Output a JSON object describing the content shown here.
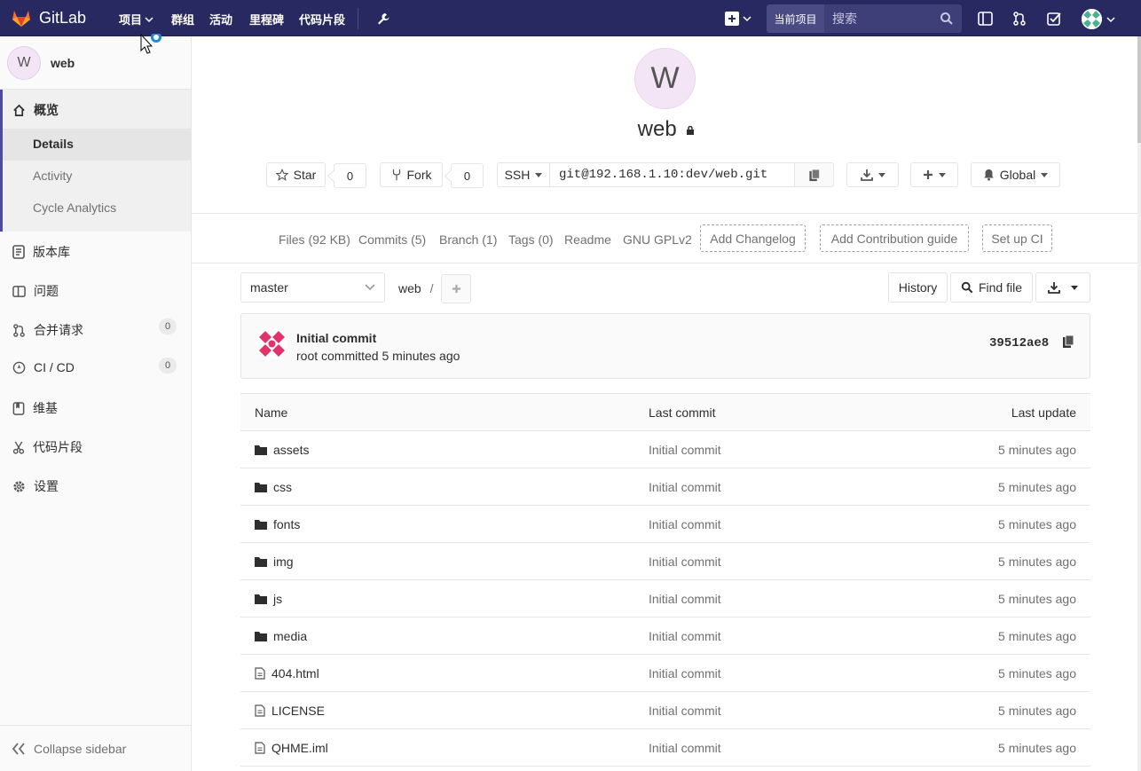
{
  "navbar": {
    "brand": "GitLab",
    "links": [
      "项目",
      "群组",
      "活动",
      "里程碑",
      "代码片段"
    ],
    "scope": "当前项目",
    "search_placeholder": "搜索"
  },
  "sidebar": {
    "project_initial": "W",
    "project_name": "web",
    "overview_label": "概览",
    "sub_items": [
      "Details",
      "Activity",
      "Cycle Analytics"
    ],
    "items": [
      {
        "label": "版本库",
        "icon": "repository-icon"
      },
      {
        "label": "问题",
        "icon": "issues-icon",
        "badge": "0"
      },
      {
        "label": "合并请求",
        "icon": "merge-request-icon",
        "badge": "0"
      },
      {
        "label": "CI / CD",
        "icon": "rocket-icon"
      },
      {
        "label": "维基",
        "icon": "book-icon"
      },
      {
        "label": "代码片段",
        "icon": "scissors-icon"
      },
      {
        "label": "设置",
        "icon": "gear-icon"
      }
    ],
    "collapse_label": "Collapse sidebar"
  },
  "project": {
    "initial": "W",
    "name": "web",
    "star_label": "Star",
    "star_count": "0",
    "fork_label": "Fork",
    "fork_count": "0",
    "clone_protocol": "SSH",
    "clone_url": "git@192.168.1.10:dev/web.git",
    "notification_label": "Global"
  },
  "stats": {
    "files": "Files (92 KB)",
    "commits": "Commits (5)",
    "branch": "Branch (1)",
    "tags": "Tags (0)",
    "readme": "Readme",
    "license": "GNU GPLv2",
    "add_changelog": "Add Changelog",
    "add_contribution": "Add Contribution guide",
    "setup_ci": "Set up CI"
  },
  "tree_nav": {
    "branch": "master",
    "crumb": "web",
    "crumb_sep": "/",
    "history_label": "History",
    "find_file_label": "Find file"
  },
  "last_commit": {
    "title": "Initial commit",
    "meta": "root committed 5 minutes ago",
    "sha": "39512ae8"
  },
  "tree": {
    "headers": {
      "name": "Name",
      "last_commit": "Last commit",
      "last_update": "Last update"
    },
    "rows": [
      {
        "name": "assets",
        "type": "folder",
        "commit": "Initial commit",
        "updated": "5 minutes ago"
      },
      {
        "name": "css",
        "type": "folder",
        "commit": "Initial commit",
        "updated": "5 minutes ago"
      },
      {
        "name": "fonts",
        "type": "folder",
        "commit": "Initial commit",
        "updated": "5 minutes ago"
      },
      {
        "name": "img",
        "type": "folder",
        "commit": "Initial commit",
        "updated": "5 minutes ago"
      },
      {
        "name": "js",
        "type": "folder",
        "commit": "Initial commit",
        "updated": "5 minutes ago"
      },
      {
        "name": "media",
        "type": "folder",
        "commit": "Initial commit",
        "updated": "5 minutes ago"
      },
      {
        "name": "404.html",
        "type": "file",
        "commit": "Initial commit",
        "updated": "5 minutes ago"
      },
      {
        "name": "LICENSE",
        "type": "file",
        "commit": "Initial commit",
        "updated": "5 minutes ago"
      },
      {
        "name": "QHME.iml",
        "type": "file",
        "commit": "Initial commit",
        "updated": "5 minutes ago"
      }
    ]
  },
  "colors": {
    "navbar": "#292961",
    "accent": "#4b4ba3",
    "logo": "#e24329"
  }
}
